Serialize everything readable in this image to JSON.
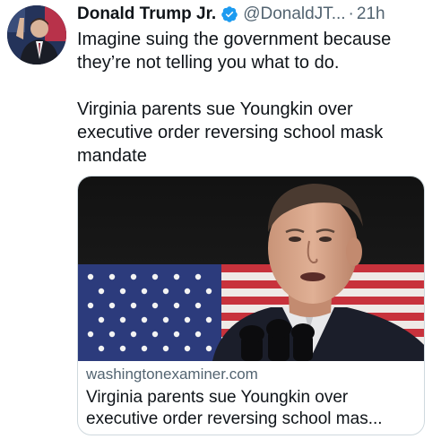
{
  "author": {
    "display_name": "Donald Trump Jr.",
    "handle": "@DonaldJT...",
    "separator": "·",
    "time": "21h",
    "verified": true,
    "avatar": "profile-photo"
  },
  "tweet": {
    "text_line1": "Imagine suing the government because they’re not telling you what to do.",
    "text_line2": "Virginia parents sue Youngkin over executive order reversing school mask mandate"
  },
  "card": {
    "image": "photo-man-speaking-at-microphones-with-us-flag",
    "domain": "washingtonexaminer.com",
    "title": "Virginia parents sue Youngkin over executive order reversing school mas..."
  },
  "colors": {
    "text_primary": "#0f1419",
    "text_secondary": "#536471",
    "verified_badge": "#1d9bf0",
    "card_border": "#cfd9de"
  }
}
